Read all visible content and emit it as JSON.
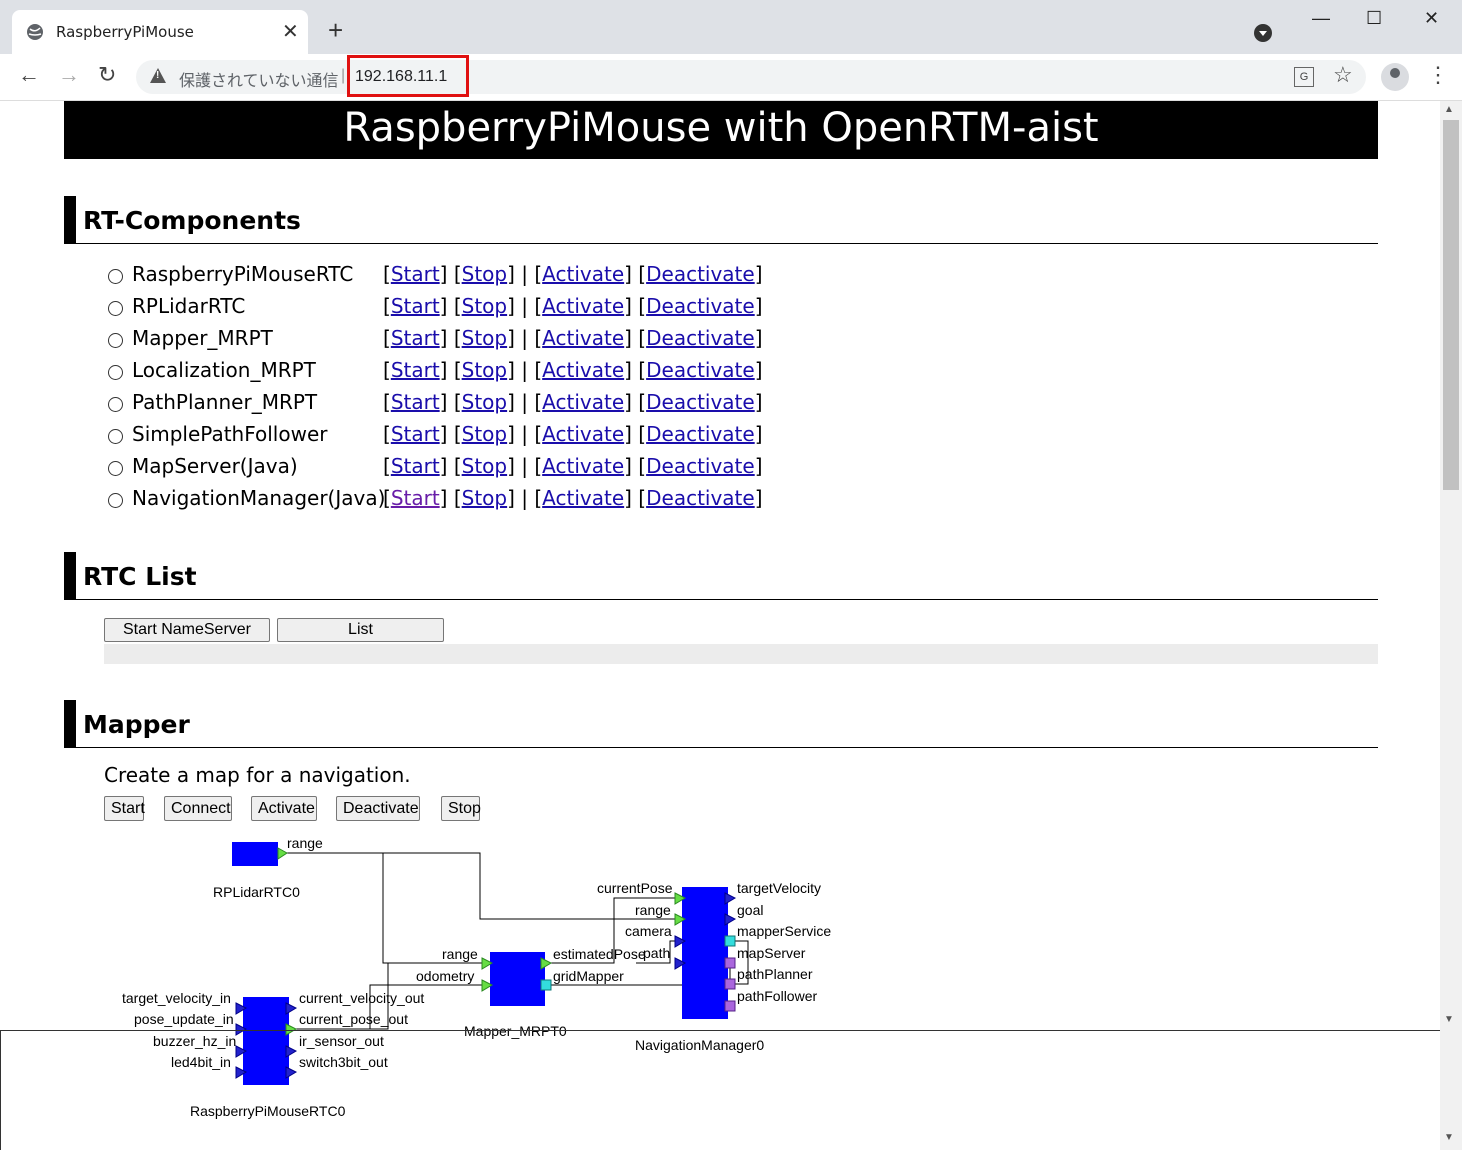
{
  "browser": {
    "tab_title": "RaspberryPiMouse",
    "insecure_label": "保護されていない通信",
    "separator": "|",
    "url": "192.168.11.1",
    "translate_label": "G",
    "window_controls": {
      "minimize": "—",
      "maximize": "☐",
      "close": "✕"
    }
  },
  "banner": "RaspberryPiMouse with OpenRTM-aist",
  "rt_components": {
    "heading": "RT-Components",
    "items": [
      {
        "name": "RaspberryPiMouseRTC"
      },
      {
        "name": "RPLidarRTC"
      },
      {
        "name": "Mapper_MRPT"
      },
      {
        "name": "Localization_MRPT"
      },
      {
        "name": "PathPlanner_MRPT"
      },
      {
        "name": "SimplePathFollower"
      },
      {
        "name": "MapServer(Java)"
      },
      {
        "name": "NavigationManager(Java)"
      }
    ],
    "link_labels": {
      "start": "Start",
      "stop": "Stop",
      "activate": "Activate",
      "deactivate": "Deactivate"
    },
    "visited_start_index": 7
  },
  "rtc_list": {
    "heading": "RTC List",
    "start_nameserver": "Start NameServer",
    "list": "List"
  },
  "mapper": {
    "heading": "Mapper",
    "description": "Create a map for a navigation.",
    "buttons": {
      "start": "Start",
      "connect": "Connect",
      "activate": "Activate",
      "deactivate": "Deactivate",
      "stop": "Stop"
    },
    "diagram": {
      "rplidar": {
        "name": "RPLidarRTC0",
        "ports": [
          "range"
        ]
      },
      "mapper": {
        "name": "Mapper_MRPT0",
        "in_ports": [
          "range",
          "odometry"
        ],
        "out_ports": [
          "estimatedPose",
          "gridMapper"
        ]
      },
      "navmgr": {
        "name": "NavigationManager0",
        "in_ports": [
          "currentPose",
          "range",
          "camera",
          "path"
        ],
        "out_ports": [
          "targetVelocity",
          "goal",
          "mapperService",
          "mapServer",
          "pathPlanner",
          "pathFollower"
        ]
      },
      "raspi": {
        "name": "RaspberryPiMouseRTC0",
        "in_ports": [
          "target_velocity_in",
          "pose_update_in",
          "buzzer_hz_in",
          "led4bit_in"
        ],
        "out_ports": [
          "current_velocity_out",
          "current_pose_out",
          "ir_sensor_out",
          "switch3bit_out"
        ]
      }
    }
  },
  "colors": {
    "component": "#0000ff",
    "highlight": "#e01010",
    "link": "#1a0dab",
    "visited": "#681da8"
  }
}
